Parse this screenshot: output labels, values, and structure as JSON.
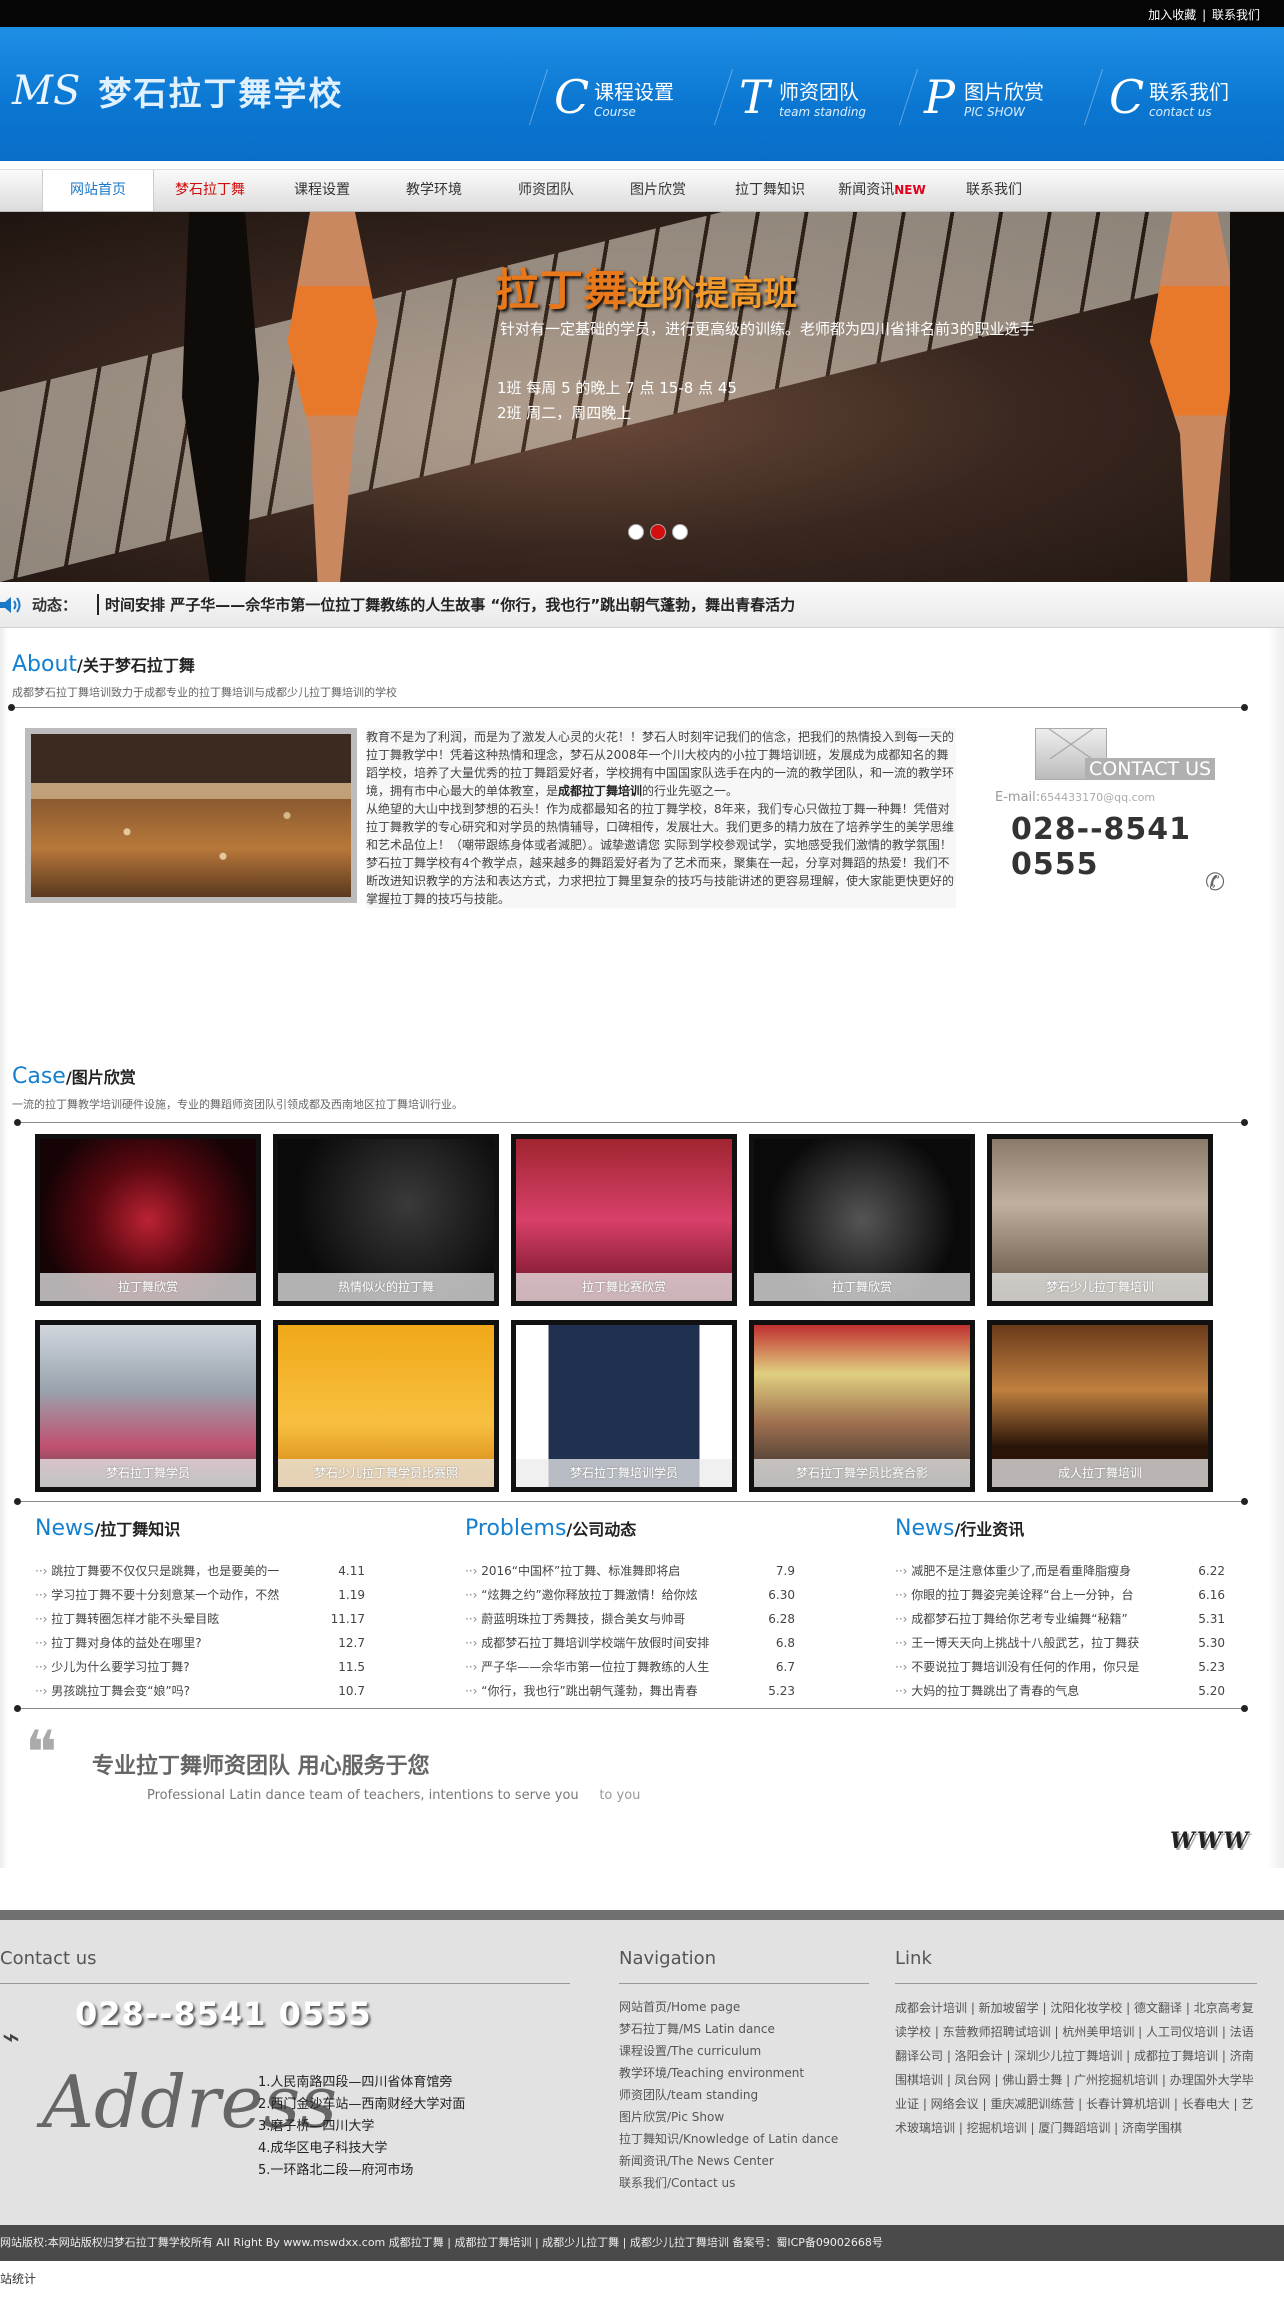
{
  "topbar": {
    "favorite": "加入收藏",
    "sep": "|",
    "contact": "联系我们"
  },
  "logo": {
    "ms": "MS",
    "name": "梦石拉丁舞学校"
  },
  "header_nav": [
    {
      "letter": "C",
      "cn": "课程设置",
      "en": "Course"
    },
    {
      "letter": "T",
      "cn": "师资团队",
      "en": "team standing"
    },
    {
      "letter": "P",
      "cn": "图片欣赏",
      "en": "PIC SHOW"
    },
    {
      "letter": "C",
      "cn": "联系我们",
      "en": "contact us"
    }
  ],
  "nav": [
    {
      "label": "网站首页"
    },
    {
      "label": "梦石拉丁舞"
    },
    {
      "label": "课程设置"
    },
    {
      "label": "教学环境"
    },
    {
      "label": "师资团队"
    },
    {
      "label": "图片欣赏"
    },
    {
      "label": "拉丁舞知识"
    },
    {
      "label": "新闻资讯",
      "badge": "NEW"
    },
    {
      "label": "联系我们"
    }
  ],
  "banner": {
    "title_big": "拉丁舞",
    "title_small": "进阶提高班",
    "subtitle": "针对有一定基础的学员，进行更高级的训练。老师都为四川省排名前3的职业选手",
    "line1": "1班  每周  5  的晚上 7 点 15-8 点 45",
    "line2": "2班  周二，周四晚上"
  },
  "ticker": {
    "label": "动态：",
    "text": "时间安排 严子华——佘华市第一位拉丁舞教练的人生故事 “你行，我也行”跳出朝气蓬勃，舞出青春活力"
  },
  "about": {
    "heading_en": "About",
    "heading_cn": "/关于梦石拉丁舞",
    "desc": "成都梦石拉丁舞培训致力于成都专业的拉丁舞培训与成都少儿拉丁舞培训的学校",
    "p1": "教育不是为了利润，而是为了激发人心灵的火花！！梦石人时刻牢记我们的信念，把我们的热情投入到每一天的拉丁舞教学中！凭着这种热情和理念，梦石从2008年一个川大校内的小拉丁舞培训班，发展成为成都知名的舞蹈学校，培养了大量优秀的拉丁舞蹈爱好者，学校拥有中国国家队选手在内的一流的教学团队，和一流的教学环境，拥有市中心最大的单体教室，是",
    "p1_bold": "成都拉丁舞培训",
    "p1_end": "的行业先驱之一。",
    "p2": "从绝望的大山中找到梦想的石头！作为成都最知名的拉丁舞学校，8年来，我们专心只做拉丁舞一种舞！凭借对拉丁舞教学的专心研究和对学员的热情辅导，口碑相传，发展壮大。我们更多的精力放在了培养学生的美学思维和艺术品位上！（嘲带跟练身体或者減肥）。诚挚邀请您 实际到学校参观试学，实地感受我们激情的教学氛围！",
    "p3": "梦石拉丁舞学校有4个教学点，越来越多的舞蹈爱好者为了艺术而来，聚集在一起，分享对舞蹈的热爱！我们不断改进知识教学的方法和表达方式，力求把拉丁舞里复杂的技巧与技能讲述的更容易理解，使大家能更快更好的掌握拉丁舞的技巧与技能。"
  },
  "contact_card": {
    "label": "CONTACT US",
    "email_prefix": "E-mail:",
    "email": "654433170@qq.com",
    "phone": "028--8541 0555"
  },
  "case": {
    "heading_en": "Case",
    "heading_cn": "/图片欣赏",
    "desc": "一流的拉丁舞教学培训硬件设施，专业的舞蹈师资团队引领成都及西南地区拉丁舞培训行业。",
    "items": [
      {
        "cap": "拉丁舞欣赏"
      },
      {
        "cap": "热情似火的拉丁舞"
      },
      {
        "cap": "拉丁舞比赛欣赏"
      },
      {
        "cap": "拉丁舞欣赏"
      },
      {
        "cap": "梦石少儿拉丁舞培训"
      },
      {
        "cap": "梦石拉丁舞学员"
      },
      {
        "cap": "梦石少儿拉丁舞学员比赛照"
      },
      {
        "cap": "梦石拉丁舞培训学员"
      },
      {
        "cap": "梦石拉丁舞学员比赛合影"
      },
      {
        "cap": "成人拉丁舞培训"
      }
    ]
  },
  "news_cols": [
    {
      "en": "News",
      "cn": "/拉丁舞知识",
      "rows": [
        {
          "t": "跳拉丁舞要不仅仅只是跳舞，也是要美的一",
          "d": "4.11"
        },
        {
          "t": "学习拉丁舞不要十分刻意某一个动作，不然",
          "d": "1.19"
        },
        {
          "t": "拉丁舞转圈怎样才能不头晕目眩",
          "d": "11.17"
        },
        {
          "t": "拉丁舞对身体的益处在哪里?",
          "d": "12.7"
        },
        {
          "t": "少儿为什么要学习拉丁舞?",
          "d": "11.5"
        },
        {
          "t": "男孩跳拉丁舞会变“娘”吗?",
          "d": "10.7"
        }
      ]
    },
    {
      "en": "Problems",
      "cn": "/公司动态",
      "rows": [
        {
          "t": "2016“中国杯”拉丁舞、标准舞即将启",
          "d": "7.9"
        },
        {
          "t": "“炫舞之约”邀你释放拉丁舞激情！给你炫",
          "d": "6.30"
        },
        {
          "t": "蔚蓝明珠拉丁秀舞技，撷合美女与帅哥",
          "d": "6.28"
        },
        {
          "t": "成都梦石拉丁舞培训学校端午放假时间安排",
          "d": "6.8"
        },
        {
          "t": "严子华——佘华市第一位拉丁舞教练的人生",
          "d": "6.7"
        },
        {
          "t": "“你行，我也行”跳出朝气蓬勃，舞出青春",
          "d": "5.23"
        }
      ]
    },
    {
      "en": "News",
      "cn": "/行业资讯",
      "rows": [
        {
          "t": "减肥不是注意体重少了,而是看重降脂瘦身",
          "d": "6.22"
        },
        {
          "t": "你眼的拉丁舞姿完美诠释“台上一分钟，台",
          "d": "6.16"
        },
        {
          "t": "成都梦石拉丁舞给你艺考专业编舞“秘籍”",
          "d": "5.31"
        },
        {
          "t": "王一博天天向上挑战十八般武艺，拉丁舞获",
          "d": "5.30"
        },
        {
          "t": "不要说拉丁舞培训没有任何的作用，你只是",
          "d": "5.23"
        },
        {
          "t": "大妈的拉丁舞跳出了青春的气息",
          "d": "5.20"
        }
      ]
    }
  ],
  "slogan": {
    "quote": "❝",
    "cn": "专业拉丁舞师资团队   用心服务于您",
    "en": "Professional Latin dance team of teachers, intentions to serve you",
    "en2": "to you",
    "www": "WWW"
  },
  "footer": {
    "contact_h": "Contact us",
    "phone": "028--8541 0555",
    "address_word": "Address",
    "addresses": [
      "1.人民南路四段—四川省体育馆旁",
      "2.西门金沙车站—西南财经大学对面",
      "3.磨子桥—四川大学",
      "4.成华区电子科技大学",
      "5.一环路北二段—府河市场"
    ],
    "nav_h": "Navigation",
    "nav": [
      "网站首页/Home page",
      "梦石拉丁舞/MS Latin dance",
      "课程设置/The curriculum",
      "教学环境/Teaching environment",
      "师资团队/team standing",
      "图片欣赏/Pic Show",
      "拉丁舞知识/Knowledge of Latin dance",
      "新闻资讯/The News Center",
      "联系我们/Contact us"
    ],
    "link_h": "Link",
    "links": "成都会计培训 | 新加坡留学 | 沈阳化妆学校 | 德文翻译 | 北京高考复读学校 | 东营教师招聘试培训 | 杭州美甲培训 | 人工司仪培训 | 法语翻译公司 | 洛阳会计 | 深圳少儿拉丁舞培训 | 成都拉丁舞培训 | 济南围棋培训 | 凤台网 | 佛山爵士舞 | 广州挖掘机培训 | 办理国外大学毕业证 | 网络会议 | 重庆减肥训练营 | 长春计算机培训 | 长春电大 | 艺术玻璃培训 | 挖掘机培训 | 厦门舞蹈培训 | 济南学围棋"
  },
  "copyright": "网站版权:本网站版权归梦石拉丁舞学校所有 All Right By www.mswdxx.com   成都拉丁舞 | 成都拉丁舞培训 | 成都少儿拉丁舞 | 成都少儿拉丁舞培训  备案号：蜀ICP备09002668号",
  "stat": "站统计"
}
